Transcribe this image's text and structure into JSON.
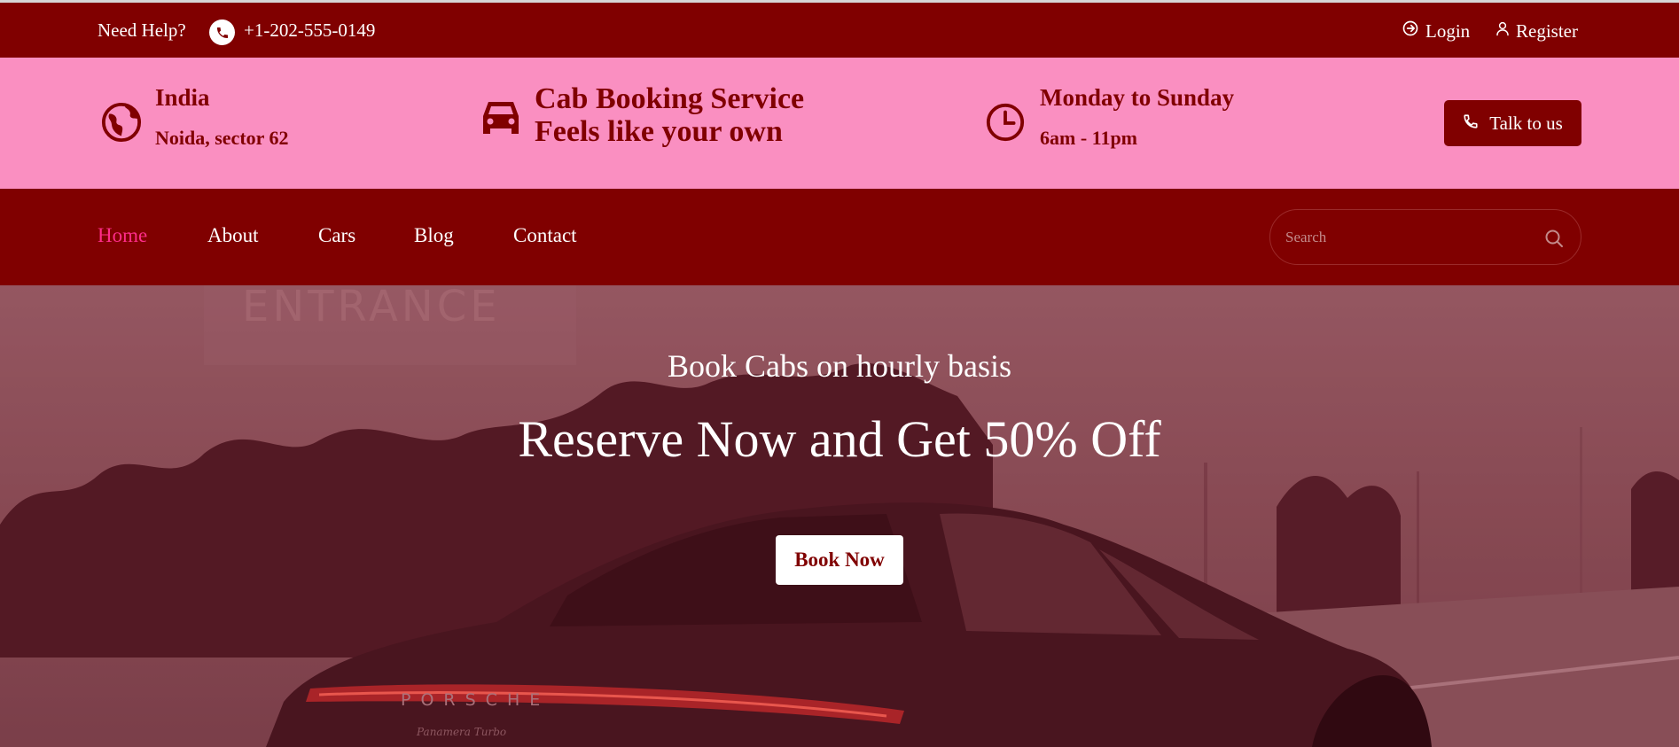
{
  "topbar": {
    "help_text": "Need Help?",
    "phone": "+1-202-555-0149",
    "login_label": "Login",
    "register_label": "Register"
  },
  "info": {
    "location_title": "India",
    "location_sub": "Noida, sector 62",
    "brand_line1": "Cab Booking Service",
    "brand_line2": "Feels like your own",
    "hours_title": "Monday to Sunday",
    "hours_sub": "6am - 11pm",
    "talk_label": "Talk to us"
  },
  "nav": {
    "items": [
      {
        "label": "Home",
        "active": true
      },
      {
        "label": "About"
      },
      {
        "label": "Cars"
      },
      {
        "label": "Blog"
      },
      {
        "label": "Contact"
      }
    ],
    "search_placeholder": "Search"
  },
  "hero": {
    "eyebrow": "Book Cabs on hourly basis",
    "headline": "Reserve Now and Get 50% Off",
    "button_label": "Book Now",
    "sign_text": "ENTRANCE",
    "car_brand": "PORSCHE",
    "car_model": "Panamera Turbo"
  },
  "colors": {
    "primary": "#800000",
    "band": "#fa8fc1",
    "active_nav": "#ff2c8a"
  },
  "icons": [
    "phone-icon",
    "login-icon",
    "user-icon",
    "globe-icon",
    "car-icon",
    "clock-icon",
    "search-icon"
  ]
}
